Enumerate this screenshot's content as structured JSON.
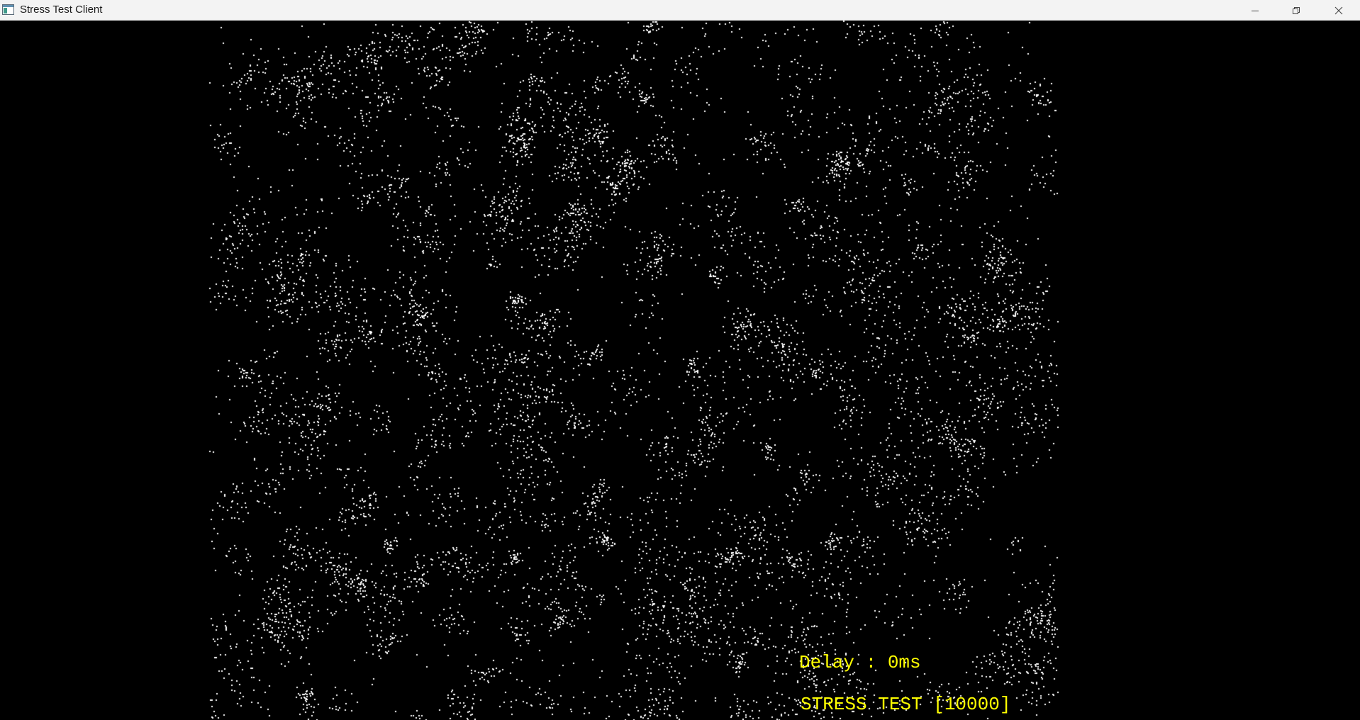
{
  "window": {
    "title": "Stress Test Client",
    "icon": "app-window-icon",
    "controls": {
      "minimize_icon": "minimize-icon",
      "maximize_icon": "restore-icon",
      "close_icon": "close-icon"
    }
  },
  "simulation": {
    "background_color": "#000000",
    "particle_color": "#ffffff",
    "particle_count": 10000
  },
  "hud": {
    "delay_text": "Delay : 0ms",
    "stress_text": "STRESS TEST [10000]",
    "text_color": "#ffff00"
  }
}
